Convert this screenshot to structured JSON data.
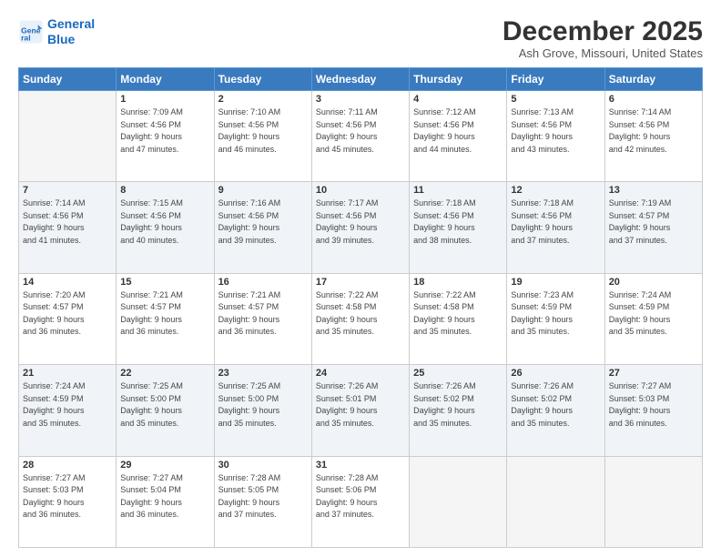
{
  "logo": {
    "line1": "General",
    "line2": "Blue"
  },
  "header": {
    "title": "December 2025",
    "subtitle": "Ash Grove, Missouri, United States"
  },
  "days_of_week": [
    "Sunday",
    "Monday",
    "Tuesday",
    "Wednesday",
    "Thursday",
    "Friday",
    "Saturday"
  ],
  "weeks": [
    [
      {
        "num": "",
        "info": ""
      },
      {
        "num": "1",
        "info": "Sunrise: 7:09 AM\nSunset: 4:56 PM\nDaylight: 9 hours\nand 47 minutes."
      },
      {
        "num": "2",
        "info": "Sunrise: 7:10 AM\nSunset: 4:56 PM\nDaylight: 9 hours\nand 46 minutes."
      },
      {
        "num": "3",
        "info": "Sunrise: 7:11 AM\nSunset: 4:56 PM\nDaylight: 9 hours\nand 45 minutes."
      },
      {
        "num": "4",
        "info": "Sunrise: 7:12 AM\nSunset: 4:56 PM\nDaylight: 9 hours\nand 44 minutes."
      },
      {
        "num": "5",
        "info": "Sunrise: 7:13 AM\nSunset: 4:56 PM\nDaylight: 9 hours\nand 43 minutes."
      },
      {
        "num": "6",
        "info": "Sunrise: 7:14 AM\nSunset: 4:56 PM\nDaylight: 9 hours\nand 42 minutes."
      }
    ],
    [
      {
        "num": "7",
        "info": "Sunrise: 7:14 AM\nSunset: 4:56 PM\nDaylight: 9 hours\nand 41 minutes."
      },
      {
        "num": "8",
        "info": "Sunrise: 7:15 AM\nSunset: 4:56 PM\nDaylight: 9 hours\nand 40 minutes."
      },
      {
        "num": "9",
        "info": "Sunrise: 7:16 AM\nSunset: 4:56 PM\nDaylight: 9 hours\nand 39 minutes."
      },
      {
        "num": "10",
        "info": "Sunrise: 7:17 AM\nSunset: 4:56 PM\nDaylight: 9 hours\nand 39 minutes."
      },
      {
        "num": "11",
        "info": "Sunrise: 7:18 AM\nSunset: 4:56 PM\nDaylight: 9 hours\nand 38 minutes."
      },
      {
        "num": "12",
        "info": "Sunrise: 7:18 AM\nSunset: 4:56 PM\nDaylight: 9 hours\nand 37 minutes."
      },
      {
        "num": "13",
        "info": "Sunrise: 7:19 AM\nSunset: 4:57 PM\nDaylight: 9 hours\nand 37 minutes."
      }
    ],
    [
      {
        "num": "14",
        "info": "Sunrise: 7:20 AM\nSunset: 4:57 PM\nDaylight: 9 hours\nand 36 minutes."
      },
      {
        "num": "15",
        "info": "Sunrise: 7:21 AM\nSunset: 4:57 PM\nDaylight: 9 hours\nand 36 minutes."
      },
      {
        "num": "16",
        "info": "Sunrise: 7:21 AM\nSunset: 4:57 PM\nDaylight: 9 hours\nand 36 minutes."
      },
      {
        "num": "17",
        "info": "Sunrise: 7:22 AM\nSunset: 4:58 PM\nDaylight: 9 hours\nand 35 minutes."
      },
      {
        "num": "18",
        "info": "Sunrise: 7:22 AM\nSunset: 4:58 PM\nDaylight: 9 hours\nand 35 minutes."
      },
      {
        "num": "19",
        "info": "Sunrise: 7:23 AM\nSunset: 4:59 PM\nDaylight: 9 hours\nand 35 minutes."
      },
      {
        "num": "20",
        "info": "Sunrise: 7:24 AM\nSunset: 4:59 PM\nDaylight: 9 hours\nand 35 minutes."
      }
    ],
    [
      {
        "num": "21",
        "info": "Sunrise: 7:24 AM\nSunset: 4:59 PM\nDaylight: 9 hours\nand 35 minutes."
      },
      {
        "num": "22",
        "info": "Sunrise: 7:25 AM\nSunset: 5:00 PM\nDaylight: 9 hours\nand 35 minutes."
      },
      {
        "num": "23",
        "info": "Sunrise: 7:25 AM\nSunset: 5:00 PM\nDaylight: 9 hours\nand 35 minutes."
      },
      {
        "num": "24",
        "info": "Sunrise: 7:26 AM\nSunset: 5:01 PM\nDaylight: 9 hours\nand 35 minutes."
      },
      {
        "num": "25",
        "info": "Sunrise: 7:26 AM\nSunset: 5:02 PM\nDaylight: 9 hours\nand 35 minutes."
      },
      {
        "num": "26",
        "info": "Sunrise: 7:26 AM\nSunset: 5:02 PM\nDaylight: 9 hours\nand 35 minutes."
      },
      {
        "num": "27",
        "info": "Sunrise: 7:27 AM\nSunset: 5:03 PM\nDaylight: 9 hours\nand 36 minutes."
      }
    ],
    [
      {
        "num": "28",
        "info": "Sunrise: 7:27 AM\nSunset: 5:03 PM\nDaylight: 9 hours\nand 36 minutes."
      },
      {
        "num": "29",
        "info": "Sunrise: 7:27 AM\nSunset: 5:04 PM\nDaylight: 9 hours\nand 36 minutes."
      },
      {
        "num": "30",
        "info": "Sunrise: 7:28 AM\nSunset: 5:05 PM\nDaylight: 9 hours\nand 37 minutes."
      },
      {
        "num": "31",
        "info": "Sunrise: 7:28 AM\nSunset: 5:06 PM\nDaylight: 9 hours\nand 37 minutes."
      },
      {
        "num": "",
        "info": ""
      },
      {
        "num": "",
        "info": ""
      },
      {
        "num": "",
        "info": ""
      }
    ]
  ]
}
